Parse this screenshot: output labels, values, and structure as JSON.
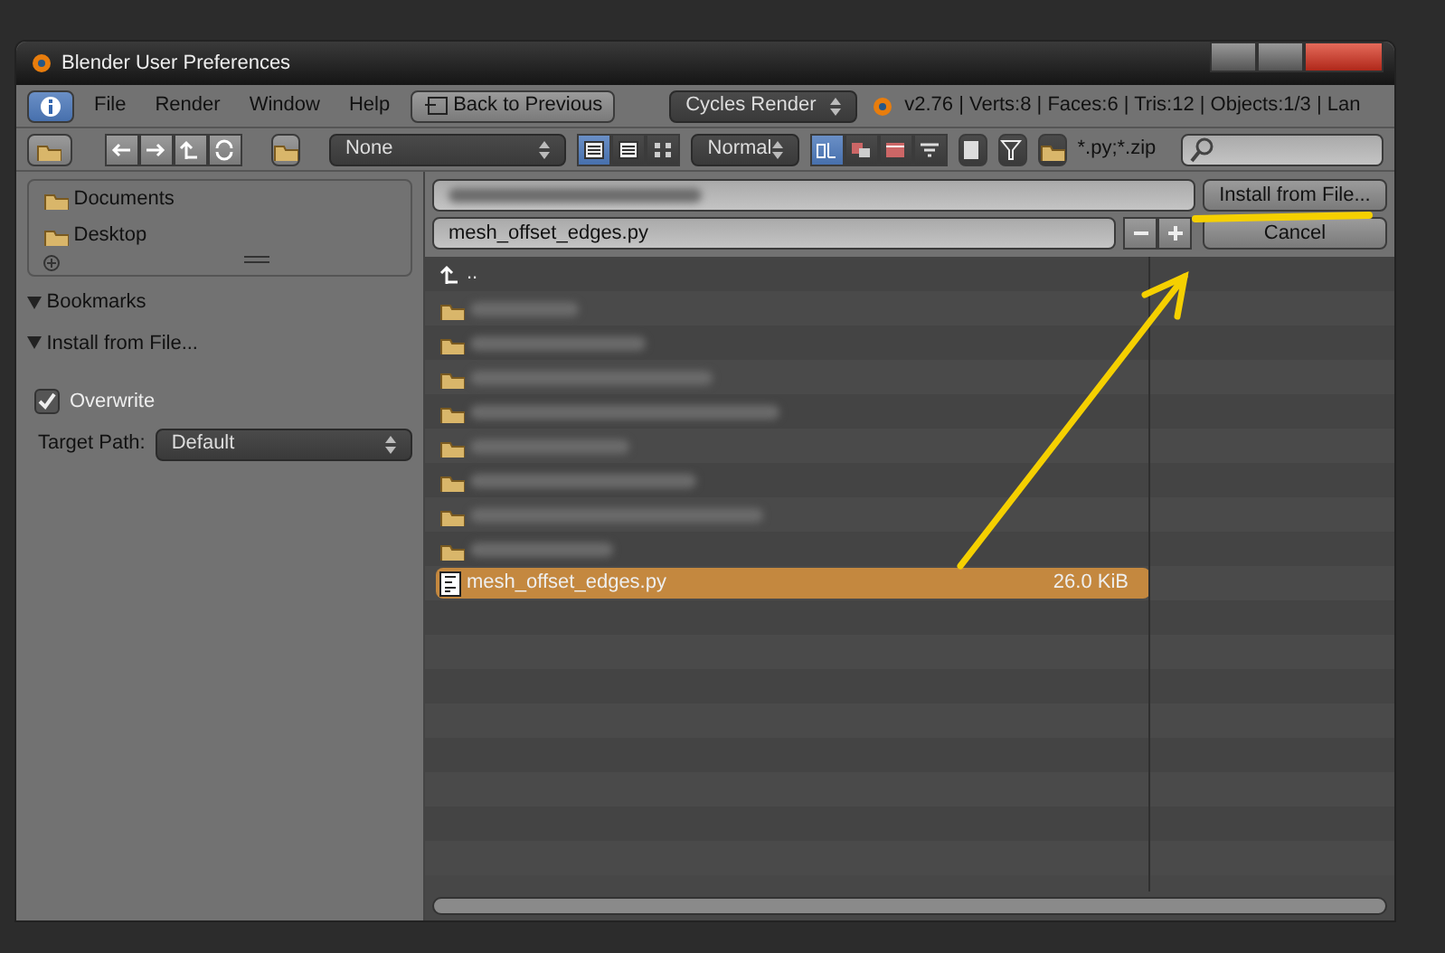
{
  "window": {
    "title": "Blender User Preferences"
  },
  "menu": [
    "File",
    "Render",
    "Window",
    "Help"
  ],
  "back_button": "Back to Previous",
  "render_engine": "Cycles Render",
  "stats": "v2.76 | Verts:8 | Faces:6 | Tris:12 | Objects:1/3 | Lan",
  "toolbar": {
    "recent_dropdown": "None",
    "display_modes": [
      {
        "selected": true
      },
      {
        "selected": false
      },
      {
        "selected": false
      }
    ],
    "size_dropdown": "Normal",
    "sort_modes": [
      {
        "selected": true
      },
      {
        "selected": false
      },
      {
        "selected": false
      },
      {
        "selected": false
      }
    ],
    "filter_glob": "*.py;*.zip"
  },
  "sidebar": {
    "system_items": [
      "Documents",
      "Desktop"
    ],
    "bookmarks_label": "Bookmarks",
    "operator": {
      "title": "Install from File...",
      "overwrite": {
        "label": "Overwrite",
        "checked": true
      },
      "target_path": {
        "label": "Target Path:",
        "value": "Default"
      }
    }
  },
  "file_browser": {
    "filename": "mesh_offset_edges.py",
    "install_button": "Install from File...",
    "cancel_button": "Cancel",
    "parent": "..",
    "files": [
      {
        "kind": "folder",
        "selected": false
      },
      {
        "kind": "folder",
        "selected": false
      },
      {
        "kind": "folder",
        "selected": false
      },
      {
        "kind": "folder",
        "selected": false
      },
      {
        "kind": "folder",
        "selected": false
      },
      {
        "kind": "folder",
        "selected": false
      },
      {
        "kind": "folder",
        "selected": false
      },
      {
        "kind": "folder",
        "selected": false
      },
      {
        "kind": "file",
        "name": "mesh_offset_edges.py",
        "size": "26.0 KiB",
        "selected": true
      }
    ]
  }
}
